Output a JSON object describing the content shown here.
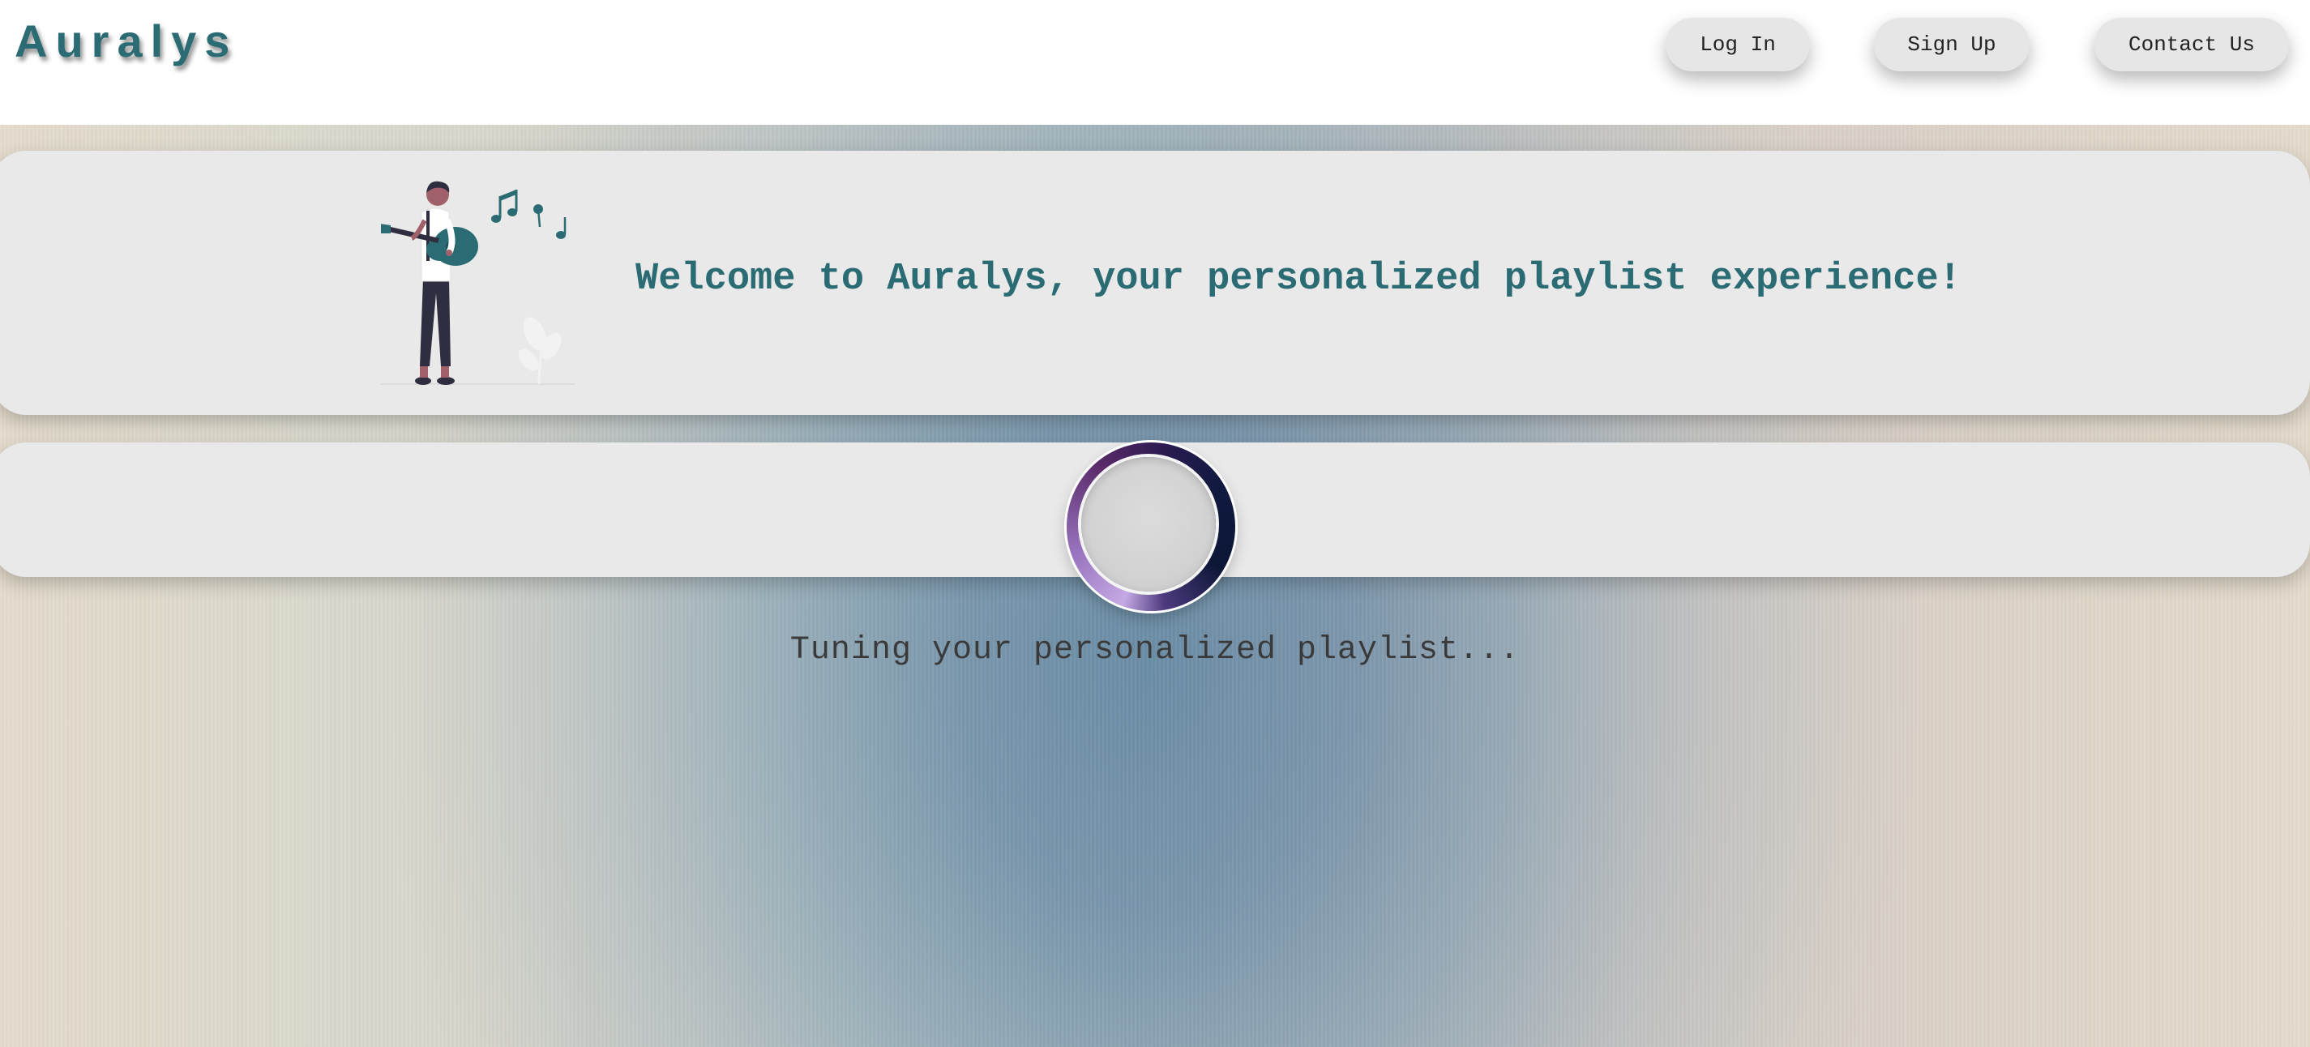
{
  "header": {
    "logo": "Auralys",
    "nav": {
      "login": "Log In",
      "signup": "Sign Up",
      "contact": "Contact Us"
    }
  },
  "welcome": {
    "message": "Welcome to Auralys, your personalized playlist experience!"
  },
  "loading": {
    "message": "Tuning your personalized playlist..."
  },
  "colors": {
    "brand": "#2b6c74",
    "card": "#e9e9e9",
    "header_bg": "#ffffff"
  }
}
